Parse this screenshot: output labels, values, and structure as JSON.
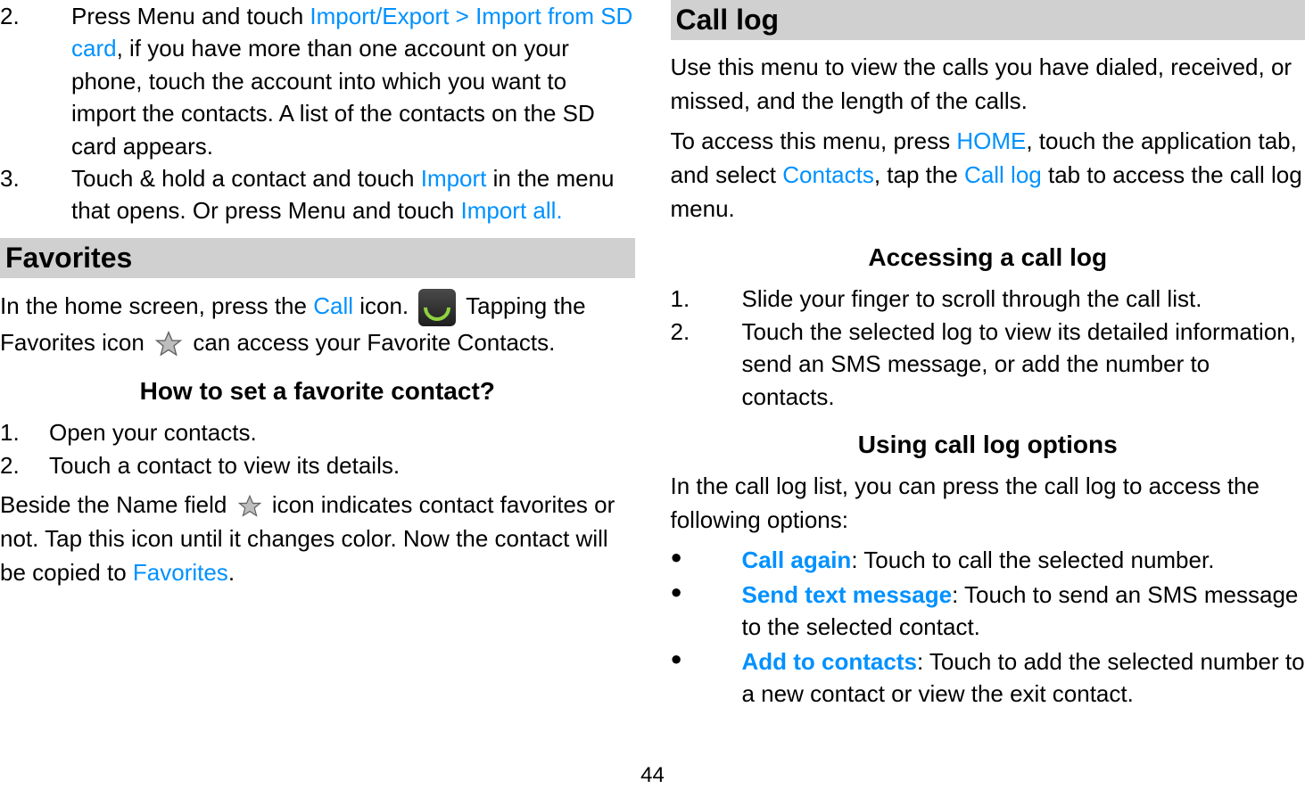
{
  "pageNumber": "44",
  "left": {
    "item2_num": "2.",
    "item2_a": "Press Menu and touch ",
    "item2_link": "Import/Export > Import from SD card",
    "item2_b": ", if you have more than one account on your phone, touch the account into which you want to import the contacts. A list of the contacts on the SD card appears.",
    "item3_num": "3.",
    "item3_a": "Touch & hold a contact and touch ",
    "item3_link": "Import",
    "item3_b": " in the menu that opens. Or press Menu and touch ",
    "item3_link2": "Import all.",
    "favorites_heading": "Favorites",
    "fav_body_a": "In the home screen, press the ",
    "fav_body_call": "Call",
    "fav_body_b": " icon. ",
    "fav_body_c": " Tapping the Favorites icon ",
    "fav_body_d": " can access your Favorite Contacts.",
    "fav_sub": "How to set a favorite contact?",
    "fav_step1_num": "1.",
    "fav_step1": "Open your contacts.",
    "fav_step2_num": "2.",
    "fav_step2": "Touch a contact to view its details.",
    "fav_beside_a": "Beside the Name field",
    "fav_beside_b": "icon indicates contact favorites or not. Tap this icon until it changes color. Now the contact will be copied to ",
    "fav_beside_link": "Favorites",
    "fav_beside_c": "."
  },
  "right": {
    "calllog_heading": "Call log",
    "calllog_intro": "Use this menu to view the calls you have dialed, received, or missed, and the length of the calls.",
    "calllog_access_a": "To access this menu, press ",
    "calllog_home": "HOME",
    "calllog_access_b": ", touch the application tab, and select ",
    "calllog_contacts": "Contacts",
    "calllog_access_c": ", tap the ",
    "calllog_tab": "Call log",
    "calllog_access_d": " tab to access the call log menu.",
    "access_sub": "Accessing a call log",
    "access_step1_num": "1.",
    "access_step1": "Slide your finger to scroll through the call list.",
    "access_step2_num": "2.",
    "access_step2": "Touch the selected log to view its detailed information, send an SMS message, or add the number to contacts.",
    "using_sub": "Using call log options",
    "using_intro": "In the call log list, you can press the call log to access the following options:",
    "opt_callagain_label": "Call again",
    "opt_callagain_text": ": Touch to call the selected number.",
    "opt_send_label": "Send text message",
    "opt_send_text": ": Touch to send an SMS message to the selected contact.",
    "opt_add_label": "Add to contacts",
    "opt_add_text": ": Touch to add the selected number to a new contact or view the exit contact."
  }
}
